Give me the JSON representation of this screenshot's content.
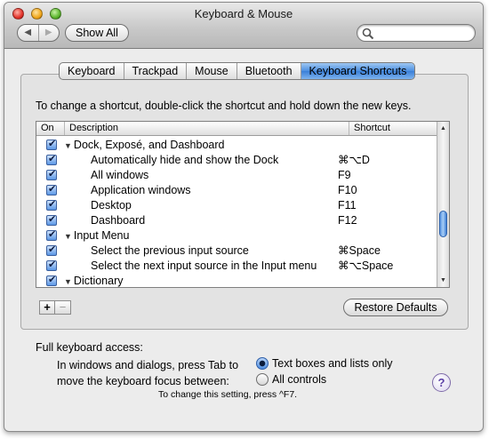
{
  "window": {
    "title": "Keyboard & Mouse"
  },
  "toolbar": {
    "back_glyph": "◀",
    "forward_glyph": "▶",
    "show_all_label": "Show All",
    "search_value": ""
  },
  "tabs": [
    {
      "label": "Keyboard",
      "selected": false
    },
    {
      "label": "Trackpad",
      "selected": false
    },
    {
      "label": "Mouse",
      "selected": false
    },
    {
      "label": "Bluetooth",
      "selected": false
    },
    {
      "label": "Keyboard Shortcuts",
      "selected": true
    }
  ],
  "instruction": "To change a shortcut, double-click the shortcut and hold down the new keys.",
  "table": {
    "headers": {
      "on": "On",
      "description": "Description",
      "shortcut": "Shortcut"
    },
    "rows": [
      {
        "checked": true,
        "group": true,
        "description": "Dock, Exposé, and Dashboard",
        "shortcut": ""
      },
      {
        "checked": true,
        "group": false,
        "description": "Automatically hide and show the Dock",
        "shortcut": "⌘⌥D"
      },
      {
        "checked": true,
        "group": false,
        "description": "All windows",
        "shortcut": "F9"
      },
      {
        "checked": true,
        "group": false,
        "description": "Application windows",
        "shortcut": "F10"
      },
      {
        "checked": true,
        "group": false,
        "description": "Desktop",
        "shortcut": "F11"
      },
      {
        "checked": true,
        "group": false,
        "description": "Dashboard",
        "shortcut": "F12"
      },
      {
        "checked": true,
        "group": true,
        "description": "Input Menu",
        "shortcut": ""
      },
      {
        "checked": true,
        "group": false,
        "description": "Select the previous input source",
        "shortcut": "⌘Space"
      },
      {
        "checked": true,
        "group": false,
        "description": "Select the next input source in the Input menu",
        "shortcut": "⌘⌥Space"
      },
      {
        "checked": true,
        "group": true,
        "description": "Dictionary",
        "shortcut": ""
      }
    ]
  },
  "buttons": {
    "add": "+",
    "remove": "−",
    "restore_defaults": "Restore Defaults"
  },
  "keyboard_access": {
    "label": "Full keyboard access:",
    "description_line1": "In windows and dialogs, press Tab to",
    "description_line2": "move the keyboard focus between:",
    "options": [
      {
        "label": "Text boxes and lists only",
        "selected": true
      },
      {
        "label": "All controls",
        "selected": false
      }
    ],
    "note": "To change this setting, press ^F7."
  },
  "help": "?",
  "colors": {
    "accent": "#3a7fd8",
    "checkbox": "#5b97e6"
  }
}
